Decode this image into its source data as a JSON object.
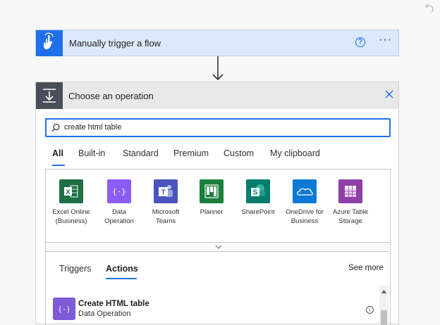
{
  "trigger": {
    "title": "Manually trigger a flow",
    "help_glyph": "?",
    "more_glyph": "···",
    "accent": "#1f6fea"
  },
  "operation": {
    "title": "Choose an operation",
    "search": {
      "value": "create html table"
    },
    "tabs": [
      {
        "label": "All",
        "active": true
      },
      {
        "label": "Built-in",
        "active": false
      },
      {
        "label": "Standard",
        "active": false
      },
      {
        "label": "Premium",
        "active": false
      },
      {
        "label": "Custom",
        "active": false
      },
      {
        "label": "My clipboard",
        "active": false
      }
    ],
    "connectors": [
      {
        "line1": "Excel Online",
        "line2": "(Business)",
        "icon": "excel-icon",
        "color": "#1d7044"
      },
      {
        "line1": "Data",
        "line2": "Operation",
        "icon": "data-operation-icon",
        "color": "#8b5cf6"
      },
      {
        "line1": "Microsoft",
        "line2": "Teams",
        "icon": "teams-icon",
        "color": "#4b53bc"
      },
      {
        "line1": "Planner",
        "line2": "",
        "icon": "planner-icon",
        "color": "#1b7f3b"
      },
      {
        "line1": "SharePoint",
        "line2": "",
        "icon": "sharepoint-icon",
        "color": "#037c6e"
      },
      {
        "line1": "OneDrive for",
        "line2": "Business",
        "icon": "onedrive-icon",
        "color": "#0d7ad5"
      },
      {
        "line1": "Azure Table",
        "line2": "Storage",
        "icon": "azure-table-icon",
        "color": "#8e3fa8"
      }
    ],
    "subtabs": {
      "triggers": "Triggers",
      "actions": "Actions",
      "see_more": "See more"
    },
    "actions": [
      {
        "name": "Create HTML table",
        "connector": "Data Operation",
        "icon": "data-operation-icon",
        "info_glyph": "i"
      }
    ]
  }
}
